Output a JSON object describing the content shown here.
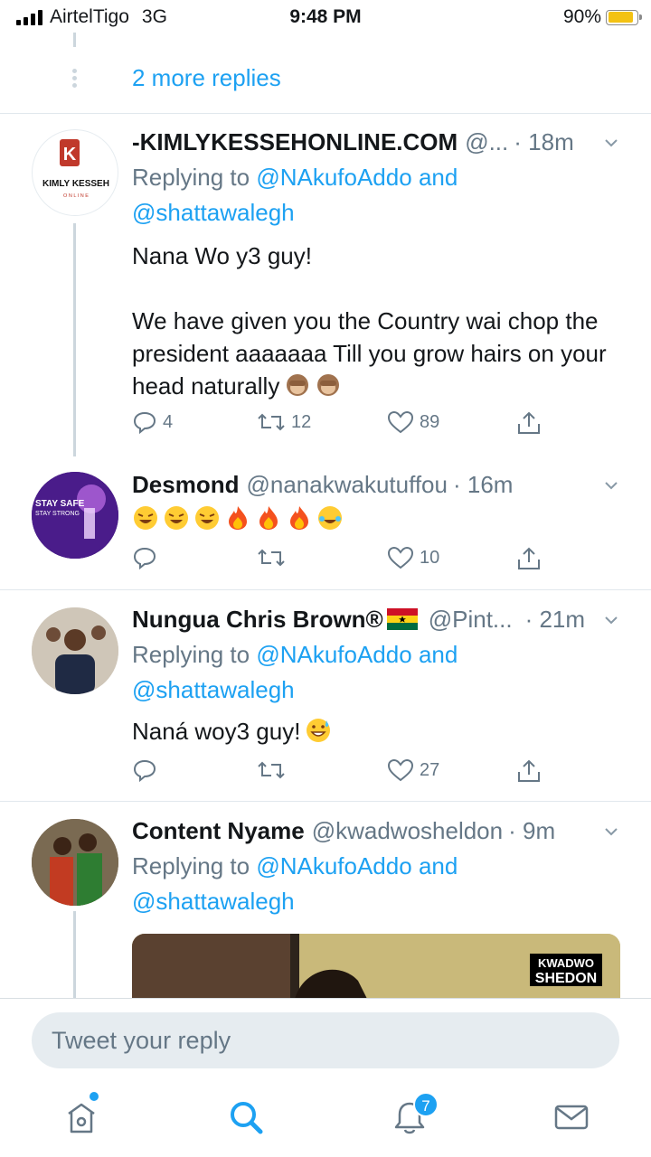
{
  "status_bar": {
    "carrier": "AirtelTigo",
    "network": "3G",
    "time": "9:48 PM",
    "battery": "90%",
    "battery_level": 0.9
  },
  "more_replies": {
    "label": "2 more replies"
  },
  "tweets": [
    {
      "name": "-KIMLYKESSEHONLINE.COM",
      "handle": "@...",
      "time": "· 18m",
      "avatar_text": "KIMLY KESSEH",
      "avatar_sub": "O N L I N E",
      "replying_prefix": "Replying to",
      "replying_user1": "@NAkufoAddo",
      "replying_and": "and",
      "replying_user2": "@shattawalegh",
      "body": "Nana Wo y3 guy!\n\nWe have given you the Country wai chop the president aaaaaaa Till you grow hairs on your head naturally",
      "body_emojis": [
        "see-no-evil-monkey",
        "see-no-evil-monkey"
      ],
      "reply_count": "4",
      "retweet_count": "12",
      "like_count": "89"
    },
    {
      "name": "Desmond",
      "handle": "@nanakwakutuffou",
      "time": "· 16m",
      "avatar_text": "STAY SAFE",
      "avatar_sub": "STAY STRONG",
      "body_emojis": [
        "rolling-laughing",
        "rolling-laughing",
        "rolling-laughing",
        "fire",
        "fire",
        "fire",
        "tears-of-joy"
      ],
      "reply_count": "",
      "retweet_count": "",
      "like_count": "10"
    },
    {
      "name": "Nungua Chris Brown®",
      "handle": "@Pint...",
      "time": "· 21m",
      "flag": "ghana-flag",
      "replying_prefix": "Replying to",
      "replying_user1": "@NAkufoAddo",
      "replying_and": "and",
      "replying_user2": "@shattawalegh",
      "body": "Naná woy3 guy!",
      "body_emojis": [
        "grinning-sweat"
      ],
      "reply_count": "",
      "retweet_count": "",
      "like_count": "27"
    },
    {
      "name": "Content Nyame",
      "handle": "@kwadwosheldon",
      "time": "· 9m",
      "replying_prefix": "Replying to",
      "replying_user1": "@NAkufoAddo",
      "replying_and": "and",
      "replying_user2": "@shattawalegh",
      "media_watermark_1": "KWADWO",
      "media_watermark_2": "SHEDON"
    }
  ],
  "compose": {
    "placeholder": "Tweet your reply"
  },
  "tab_bar": {
    "items": [
      "home-icon",
      "search-icon",
      "notifications-icon",
      "messages-icon"
    ],
    "notification_badge": "7"
  },
  "colors": {
    "accent": "#1da1f2",
    "secondary_text": "#657786",
    "divider": "#e1e8ed"
  }
}
